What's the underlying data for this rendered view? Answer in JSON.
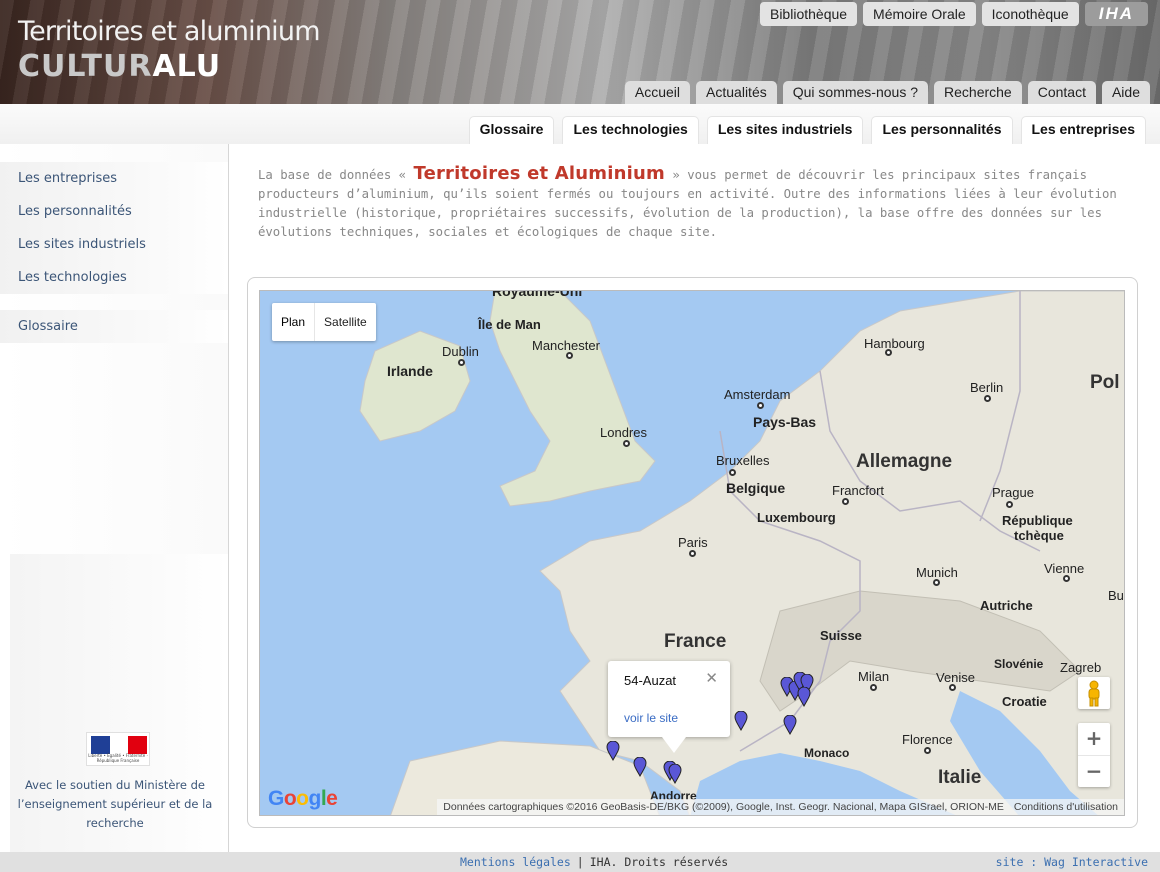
{
  "header": {
    "title": "Territoires et aluminium",
    "logo_prefix": "CULTUR",
    "logo_suffix": "ALU",
    "top_links": [
      "Bibliothèque",
      "Mémoire Orale",
      "Iconothèque"
    ],
    "partner_logo": "IHA",
    "main_tabs": [
      "Accueil",
      "Actualités",
      "Qui sommes-nous ?",
      "Recherche",
      "Contact",
      "Aide"
    ]
  },
  "sub_nav": {
    "tabs": [
      "Glossaire",
      "Les technologies",
      "Les sites industriels",
      "Les personnalités",
      "Les entreprises"
    ]
  },
  "sidebar": {
    "items": [
      "Les entreprises",
      "Les personnalités",
      "Les sites industriels",
      "Les technologies"
    ],
    "glossary": "Glossaire",
    "gov_caption": "Liberté • Égalité • Fraternité · République Française",
    "support_text": "Avec le soutien du Ministère de l’enseignement supérieur et de la recherche"
  },
  "intro": {
    "prefix": "La base de données « ",
    "highlight": "Territoires et Aluminium",
    "suffix": " » vous permet de découvrir les principaux sites français producteurs d’aluminium, qu’ils soient fermés ou toujours en activité. Outre des informations liées à leur évolution industrielle (historique, propriétaires successifs, évolution de la production), la base offre des données sur les évolutions techniques, sociales et écologiques de chaque site."
  },
  "map": {
    "map_type_options": [
      "Plan",
      "Satellite"
    ],
    "labels": {
      "royaume_uni": "Royaume-Uni",
      "ile_de_man": "Île de Man",
      "irlande": "Irlande",
      "dublin": "Dublin",
      "manchester": "Manchester",
      "londres": "Londres",
      "hambourg": "Hambourg",
      "amsterdam": "Amsterdam",
      "pays_bas": "Pays-Bas",
      "berlin": "Berlin",
      "pologne": "Pol",
      "allemagne": "Allemagne",
      "bruxelles": "Bruxelles",
      "belgique": "Belgique",
      "francfort": "Francfort",
      "prague": "Prague",
      "republique": "République",
      "tcheque": "tchèque",
      "luxembourg": "Luxembourg",
      "paris": "Paris",
      "munich": "Munich",
      "vienne": "Vienne",
      "autriche": "Autriche",
      "bu": "Bu",
      "france": "France",
      "suisse": "Suisse",
      "slovenie": "Slovénie",
      "zagreb": "Zagreb",
      "milan": "Milan",
      "venise": "Venise",
      "croatie": "Croatie",
      "florence": "Florence",
      "monaco": "Monaco",
      "italie": "Italie",
      "andorre": "Andorre"
    },
    "info_window": {
      "title": "54-Auzat",
      "close": "✕",
      "link": "voir le site"
    },
    "zoom_in": "+",
    "zoom_out": "−",
    "attribution": "Données cartographiques ©2016 GeoBasis-DE/BKG (©2009), Google, Inst. Geogr. Nacional, Mapa GISrael, ORION-ME",
    "terms": "Conditions d'utilisation",
    "google_letters": [
      "G",
      "o",
      "o",
      "g",
      "l",
      "e"
    ],
    "marker_color": "#5a57d6"
  },
  "footer": {
    "legal": "Mentions légales",
    "separator": "|",
    "rights": "IHA. Droits réservés",
    "credit": "site : Wag Interactive"
  },
  "colors": {
    "accent_red": "#c0392b",
    "link_blue": "#3b5577",
    "water": "#a4c9f2",
    "land": "#e8e6dc"
  }
}
